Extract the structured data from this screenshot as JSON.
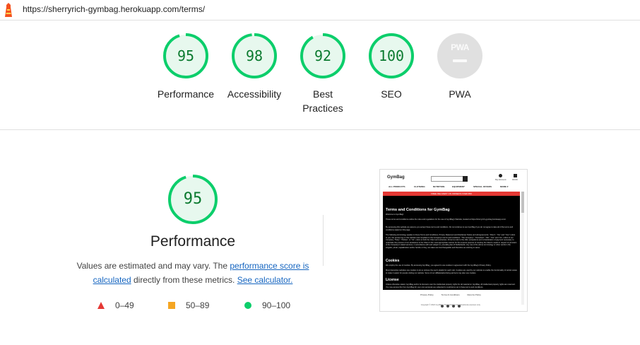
{
  "browser": {
    "url": "https://sherryrich-gymbag.herokuapp.com/terms/"
  },
  "scores": [
    {
      "label": "Performance",
      "score": 95
    },
    {
      "label": "Accessibility",
      "score": 98
    },
    {
      "label": "Best Practices",
      "score": 92
    },
    {
      "label": "SEO",
      "score": 100
    },
    {
      "label": "PWA",
      "score": null
    }
  ],
  "pwa_badge": "PWA",
  "performance": {
    "score": 95,
    "title": "Performance",
    "desc_prefix": "Values are estimated and may vary. The ",
    "link_score": "performance score is calculated",
    "desc_middle": " directly from these metrics. ",
    "link_calc": "See calculator."
  },
  "legend": [
    {
      "range": "0–49",
      "color": "#e53935"
    },
    {
      "range": "50–89",
      "color": "#f5a623"
    },
    {
      "range": "90–100",
      "color": "#0cce6b"
    }
  ],
  "colors": {
    "pass": "#0cce6b",
    "pass_text": "#0b7a2f",
    "pass_fill": "#e7f8ee",
    "link": "#1565c0"
  },
  "screenshot": {
    "brand": "GymBag",
    "search_placeholder": "Search our site",
    "account": "My Account",
    "bag": "€0.00",
    "nav": [
      "ALL PRODUCTS",
      "CLOTHING",
      "NUTRITION",
      "EQUIPMENT",
      "SPECIAL OFFERS",
      "MORE ▾"
    ],
    "banner": "FREE DELIVERY ON ORDERS OVER €50",
    "heading": "Terms and Conditions for GymBag",
    "welcome": "Welcome to GymBag!",
    "para1": "These terms and conditions outline the rules and regulations for the use of GymBag's Website, located at https://sherryrich-gymbag.herokuapp.com/.",
    "para2": "By accessing this website we assume you accept these terms and conditions. Do not continue to use GymBag if you do not agree to take all of the terms and conditions stated on this page.",
    "para3": "The following terminology applies to these Terms and Conditions, Privacy Statement and Disclaimer Notice and all Agreements: \"Client\", \"You\" and \"Your\" refers to you, the person log on this website and compliant to the Company's terms and conditions. \"The Company\", \"Ourselves\", \"We\", \"Our\" and \"Us\", refers to our Company. \"Party\", \"Parties\", or \"Us\", refers to both the Client and ourselves. All terms refer to the offer, acceptance and consideration of payment necessary to undertake the process of our assistance to the Client in the most appropriate manner for the express purpose of meeting the Client's needs in respect of provision of the Company's stated services, in accordance with and subject to, prevailing law of Netherlands. Any use of the above terminology or other words in the singular, plural, capitalization and/or he/she or they, are taken as interchangeable and therefore as referring to same.",
    "h_cookies": "Cookies",
    "para4": "We employ the use of cookies. By accessing GymBag, you agreed to use cookies in agreement with the GymBag's Privacy Policy.",
    "para5": "Most interactive websites use cookies to let us retrieve the user's details for each visit. Cookies are used by our website to enable the functionality of certain areas to make it easier for people visiting our website. Some of our affiliate/advertising partners may also use cookies.",
    "h_license": "License",
    "para6": "Unless otherwise stated, GymBag and/or its licensors own the intellectual property rights for all material on GymBag. All intellectual property rights are reserved. You may access this from GymBag for your own personal use subjected to restrictions set in these terms and conditions.",
    "footer_links": [
      "Privacy Policy",
      "Terms & Conditions",
      "Returns Policy"
    ],
    "copyright": "Copyright © 2022 GymBag. This website is for educational purposes only."
  }
}
